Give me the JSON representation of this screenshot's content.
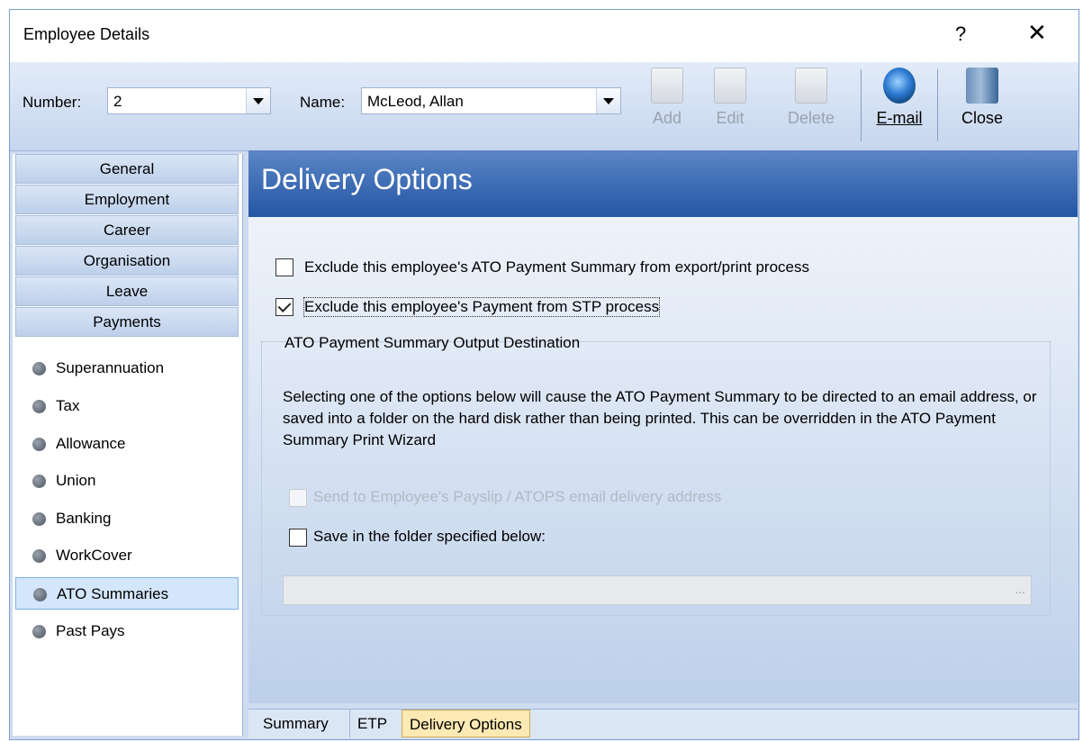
{
  "window": {
    "title": "Employee Details",
    "help": "?",
    "close": "✕"
  },
  "toolbar": {
    "number_label": "Number:",
    "number_value": "2",
    "name_label": "Name:",
    "name_value": "McLeod, Allan",
    "buttons": [
      {
        "label": "Add",
        "icon": "add-record-icon",
        "enabled": false
      },
      {
        "label": "Edit",
        "icon": "edit-record-icon",
        "enabled": false
      },
      {
        "label": "Delete",
        "icon": "delete-record-icon",
        "enabled": false
      },
      {
        "label": "E-mail",
        "icon": "email-globe-icon",
        "enabled": true
      },
      {
        "label": "Close",
        "icon": "exit-door-icon",
        "enabled": true
      }
    ]
  },
  "sidebar": {
    "sections": [
      "General",
      "Employment",
      "Career",
      "Organisation",
      "Leave",
      "Payments"
    ],
    "items": [
      "Superannuation",
      "Tax",
      "Allowance",
      "Union",
      "Banking",
      "WorkCover",
      "ATO Summaries",
      "Past Pays"
    ],
    "active_item": "ATO Summaries"
  },
  "main": {
    "title": "Delivery Options",
    "options": {
      "exclude_ato": {
        "label": "Exclude this employee's ATO Payment Summary from export/print process",
        "checked": false
      },
      "exclude_stp": {
        "label": "Exclude this employee's Payment from STP process",
        "checked": true
      }
    },
    "group": {
      "title": "ATO Payment Summary Output Destination",
      "description": "Selecting one of the options below will cause the ATO Payment Summary to be directed to an email address, or saved into a folder on the hard disk rather than being printed. This can be overridden in the ATO Payment Summary Print Wizard",
      "send_email": {
        "label": "Send to Employee's Payslip / ATOPS email delivery address",
        "checked": false,
        "enabled": false
      },
      "save_folder": {
        "label": "Save in the folder specified below:",
        "checked": false
      },
      "folder_path": "",
      "browse": "..."
    }
  },
  "tabs": [
    "Summary",
    "ETP",
    "Delivery Options"
  ],
  "active_tab": "Delivery Options"
}
